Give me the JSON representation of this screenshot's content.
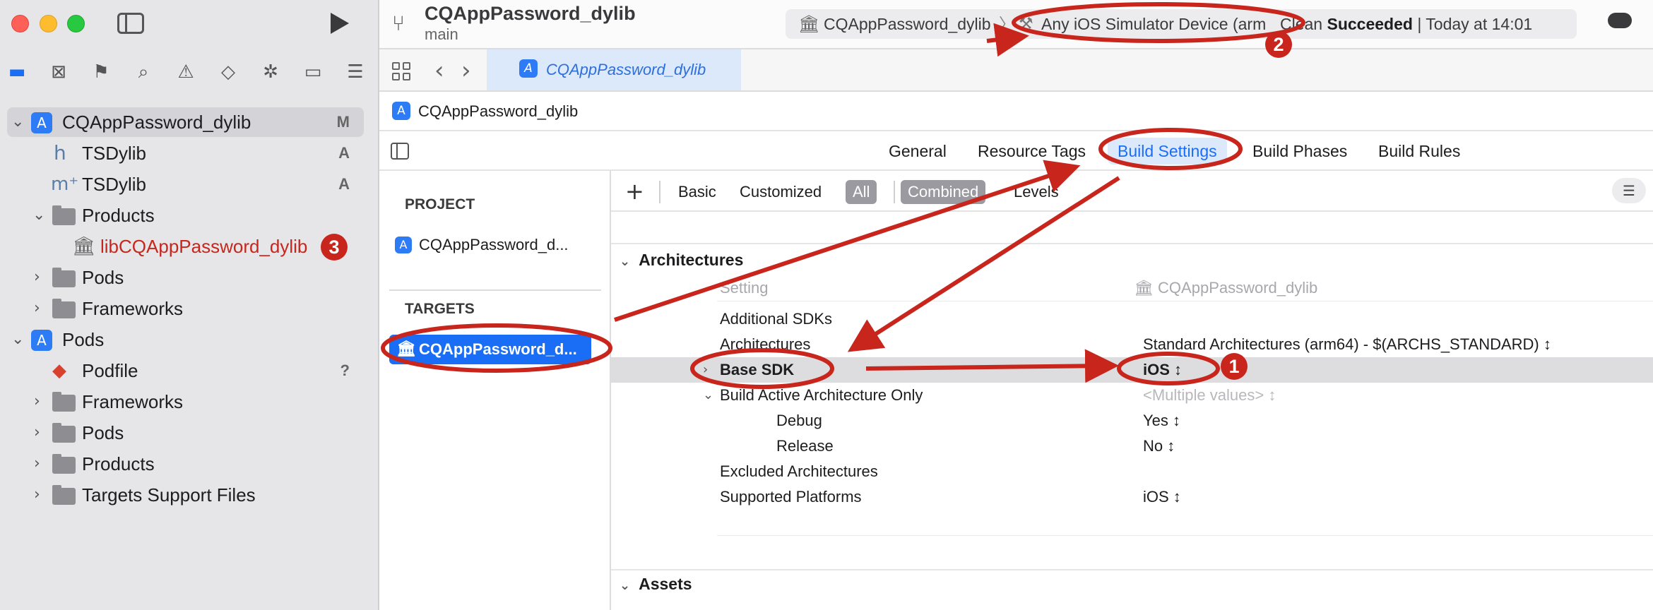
{
  "window": {
    "project_title": "CQAppPassword_dylib",
    "branch": "main"
  },
  "toolbar": {
    "scheme_name": "CQAppPassword_dylib",
    "separator": "〉",
    "device": "Any iOS Simulator Device (arm",
    "status_prefix": "Clean ",
    "status_bold": "Succeeded",
    "status_suffix": " | Today at 14:01"
  },
  "navigator": {
    "items": [
      {
        "label": "CQAppPassword_dylib",
        "badge": "M"
      },
      {
        "label": "TSDylib",
        "badge": "A"
      },
      {
        "label": "TSDylib",
        "badge": "A"
      },
      {
        "label": "Products"
      },
      {
        "label": "libCQAppPassword_dylib"
      },
      {
        "label": "Pods"
      },
      {
        "label": "Frameworks"
      },
      {
        "label": "Pods"
      },
      {
        "label": "Podfile",
        "badge": "?"
      },
      {
        "label": "Frameworks"
      },
      {
        "label": "Pods"
      },
      {
        "label": "Products"
      },
      {
        "label": "Targets Support Files"
      }
    ]
  },
  "editor": {
    "tab_label": "CQAppPassword_dylib",
    "jump_label": "CQAppPassword_dylib",
    "settings_tabs": [
      "General",
      "Resource Tags",
      "Build Settings",
      "Build Phases",
      "Build Rules"
    ]
  },
  "targets_pane": {
    "project_header": "PROJECT",
    "project_item": "CQAppPassword_d...",
    "targets_header": "TARGETS",
    "target_item": "CQAppPassword_d..."
  },
  "filters": {
    "basic": "Basic",
    "customized": "Customized",
    "all": "All",
    "combined": "Combined",
    "levels": "Levels"
  },
  "build_settings": {
    "group_architectures": "Architectures",
    "column_setting": "Setting",
    "column_target": "CQAppPassword_dylib",
    "rows": [
      {
        "name": "Additional SDKs",
        "value": ""
      },
      {
        "name": "Architectures",
        "value": "Standard Architectures (arm64)  -  $(ARCHS_STANDARD) ↕"
      },
      {
        "name": "Base SDK",
        "value": "iOS ↕"
      },
      {
        "name": "Build Active Architecture Only",
        "value": "<Multiple values> ↕"
      },
      {
        "name": "Debug",
        "value": "Yes ↕"
      },
      {
        "name": "Release",
        "value": "No ↕"
      },
      {
        "name": "Excluded Architectures",
        "value": ""
      },
      {
        "name": "Supported Platforms",
        "value": "iOS ↕"
      }
    ],
    "group_assets": "Assets"
  },
  "annotations": {
    "badge_1": "1",
    "badge_2": "2",
    "badge_3": "3",
    "color": "#c8261d"
  },
  "colors": {
    "accent": "#1a6ef5",
    "annotation_red": "#c8261d"
  }
}
